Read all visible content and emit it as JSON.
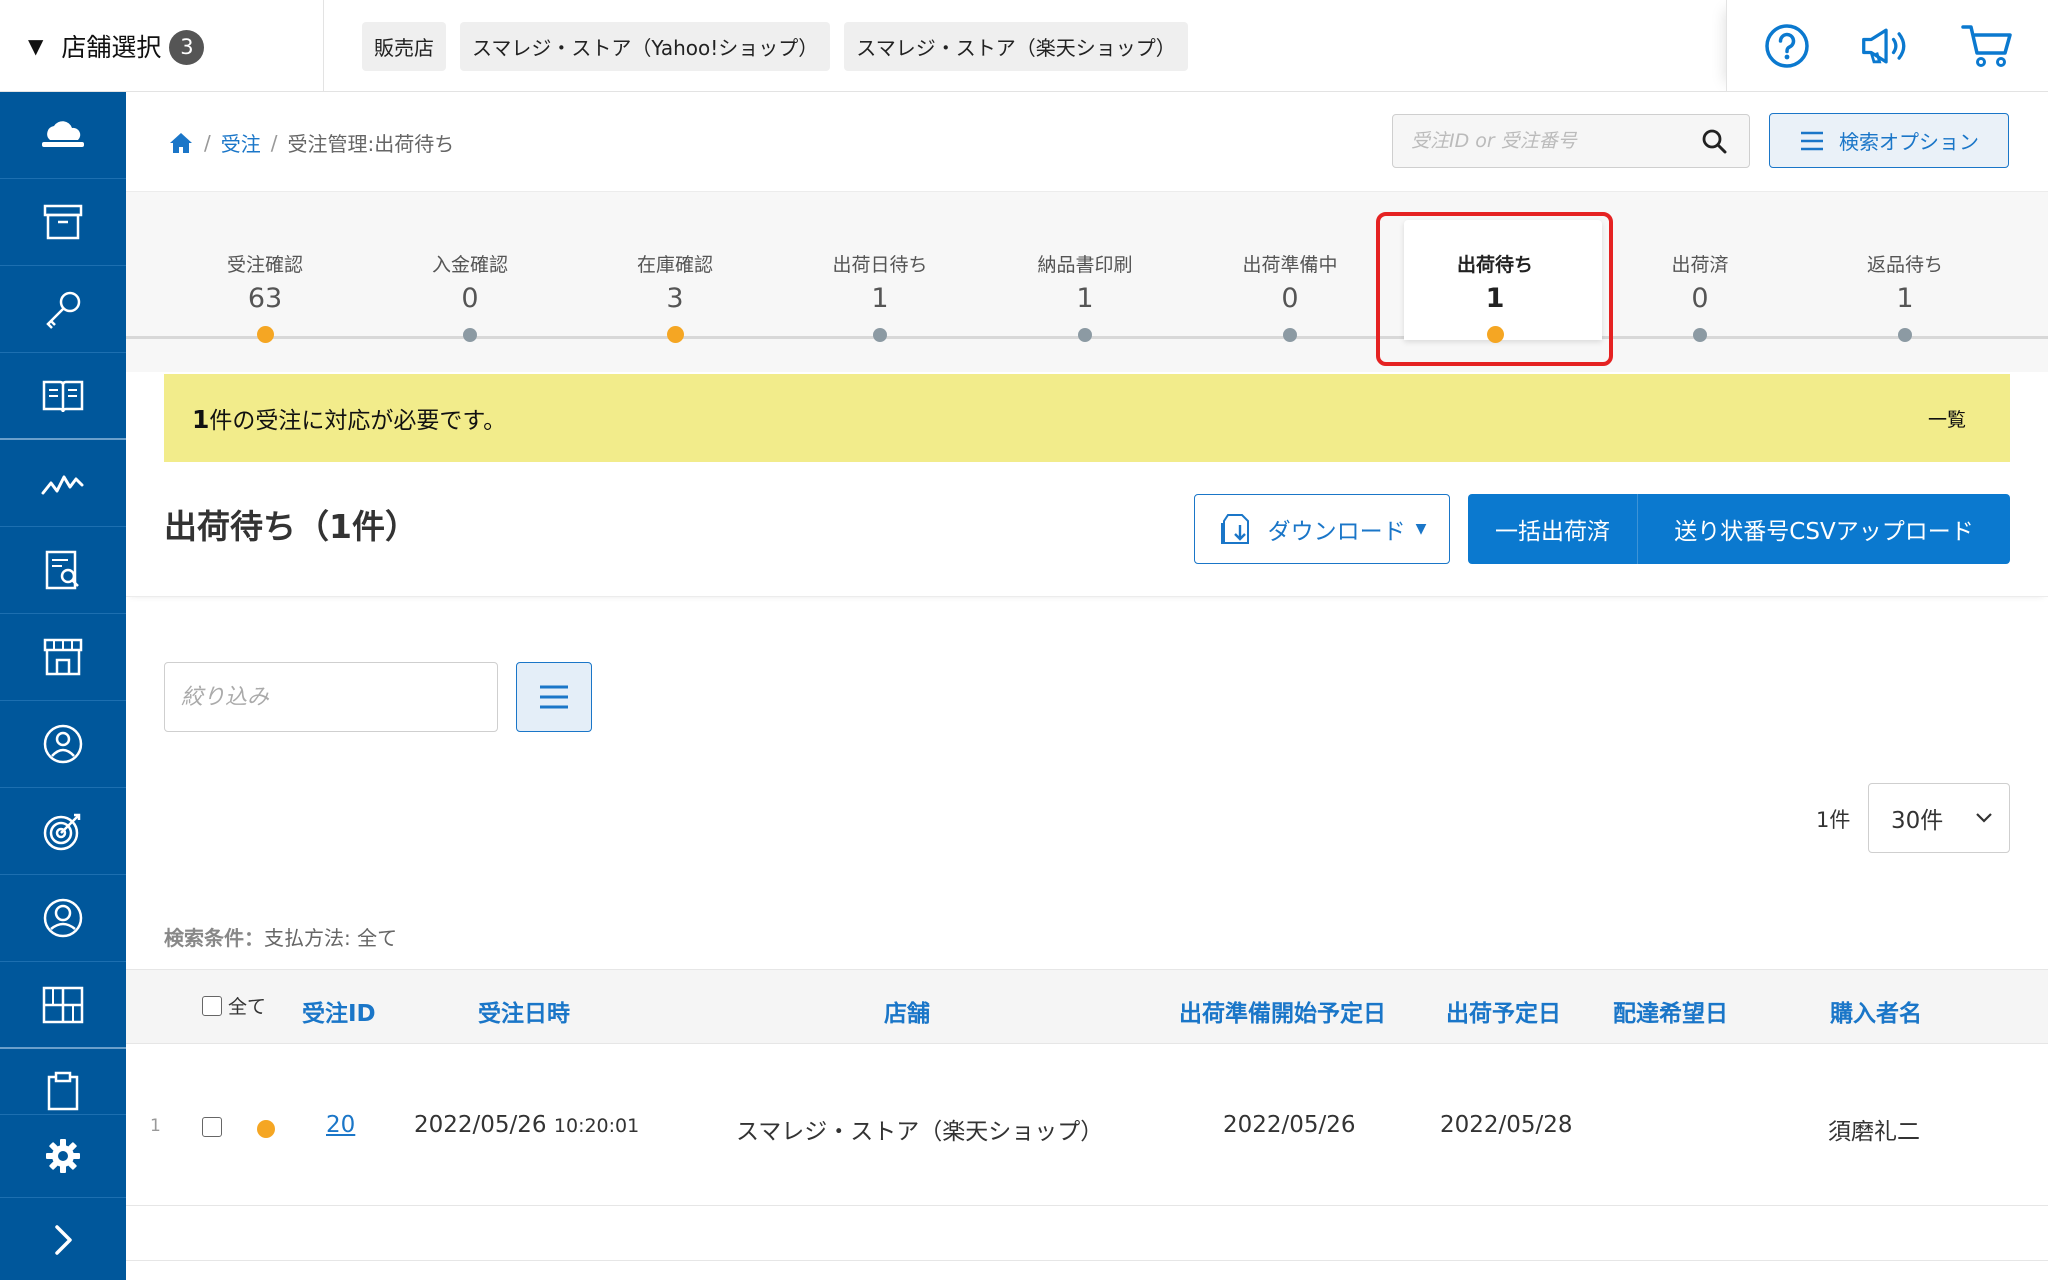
{
  "store_select": {
    "label": "店舗選択",
    "badge": "3"
  },
  "store_chips": [
    "販売店",
    "スマレジ・ストア（Yahoo!ショップ）",
    "スマレジ・ストア（楽天ショップ）"
  ],
  "top_icons": [
    "help-icon",
    "megaphone-icon",
    "cart-icon"
  ],
  "sidebar_icons": [
    "cloud-icon",
    "archive-box-icon",
    "key-icon",
    "book-icon",
    "chart-line-icon",
    "report-search-icon",
    "store-icon",
    "user-circle-icon",
    "target-icon",
    "person-circle-icon",
    "grid-icon",
    "clipboard-icon",
    "settings-icon",
    "chevron-right-icon"
  ],
  "breadcrumb": {
    "level1": "受注",
    "current": "受注管理:出荷待ち"
  },
  "search": {
    "placeholder": "受注ID or 受注番号",
    "options_label": "検索オプション"
  },
  "statuses": [
    {
      "label": "受注確認",
      "count": "63",
      "dot": "orange"
    },
    {
      "label": "入金確認",
      "count": "0",
      "dot": "gray"
    },
    {
      "label": "在庫確認",
      "count": "3",
      "dot": "orange"
    },
    {
      "label": "出荷日待ち",
      "count": "1",
      "dot": "gray"
    },
    {
      "label": "納品書印刷",
      "count": "1",
      "dot": "gray"
    },
    {
      "label": "出荷準備中",
      "count": "0",
      "dot": "gray"
    },
    {
      "label": "出荷待ち",
      "count": "1",
      "dot": "orange",
      "active": true
    },
    {
      "label": "出荷済",
      "count": "0",
      "dot": "gray"
    },
    {
      "label": "返品待ち",
      "count": "1",
      "dot": "gray"
    }
  ],
  "alert": {
    "count": "1",
    "message": "件の受注に対応が必要です。",
    "link": "一覧"
  },
  "section": {
    "title": "出荷待ち（1件）",
    "download": "ダウンロード",
    "bulk_ship": "一括出荷済",
    "csv_upload": "送り状番号CSVアップロード"
  },
  "filter": {
    "placeholder": "絞り込み"
  },
  "pagination": {
    "count": "1件",
    "per_page": "30件"
  },
  "conditions": {
    "label": "検索条件：",
    "value": "支払方法: 全て"
  },
  "table": {
    "all_label": "全て",
    "headers": [
      "受注ID",
      "受注日時",
      "店舗",
      "出荷準備開始予定日",
      "出荷予定日",
      "配達希望日",
      "購入者名"
    ],
    "rows": [
      {
        "num": "1",
        "order_id": "20",
        "date": "2022/05/26",
        "time": "10:20:01",
        "store": "スマレジ・ストア（楽天ショップ）",
        "prep_date": "2022/05/26",
        "ship_date": "2022/05/28",
        "delivery_date": "",
        "buyer": "須磨礼二"
      }
    ]
  },
  "colors": {
    "sidebar": "#00579b",
    "accent": "#1a76c8",
    "alert_bg": "#f2ec8b",
    "orange_dot": "#f5a623",
    "highlight": "#e52222"
  }
}
